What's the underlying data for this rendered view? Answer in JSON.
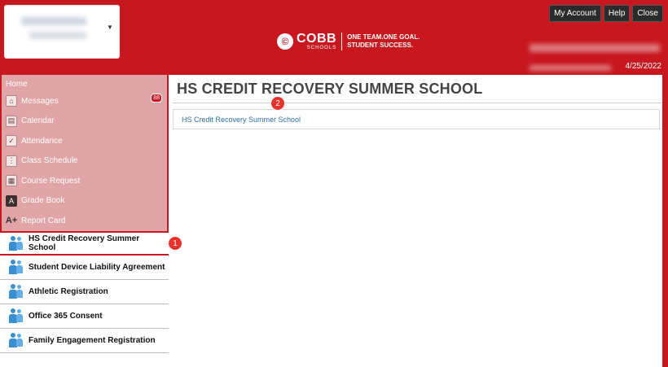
{
  "header": {
    "logo": {
      "brand": "COBB",
      "sub": "SCHOOLS",
      "tagline_1": "ONE TEAM.ONE GOAL.",
      "tagline_2": "STUDENT SUCCESS."
    },
    "buttons": {
      "my_account": "My Account",
      "help": "Help",
      "close": "Close"
    },
    "date": "4/25/2022",
    "caret": "▼"
  },
  "sidebar": {
    "home": "Home",
    "items": [
      {
        "label": "Messages",
        "icon": "⌂",
        "badge": "88"
      },
      {
        "label": "Calendar",
        "icon": "▤"
      },
      {
        "label": "Attendance",
        "icon": "✓"
      },
      {
        "label": "Class Schedule",
        "icon": "⋮"
      },
      {
        "label": "Course Request",
        "icon": "▦"
      },
      {
        "label": "Grade Book",
        "icon": "A"
      },
      {
        "label": "Report Card",
        "icon": "A+"
      }
    ],
    "forms": [
      {
        "label": "HS Credit Recovery Summer School"
      },
      {
        "label": "Student Device Liability Agreement"
      },
      {
        "label": "Athletic Registration"
      },
      {
        "label": "Office 365 Consent"
      },
      {
        "label": "Family Engagement Registration"
      }
    ]
  },
  "main": {
    "title": "HS CREDIT RECOVERY SUMMER SCHOOL",
    "link": "HS Credit Recovery Summer School"
  },
  "callouts": {
    "one": "1",
    "two": "2"
  },
  "colors": {
    "accent": "#c8171e",
    "sidebar_bg": "#e1a5a7",
    "link": "#2f6fa8"
  }
}
